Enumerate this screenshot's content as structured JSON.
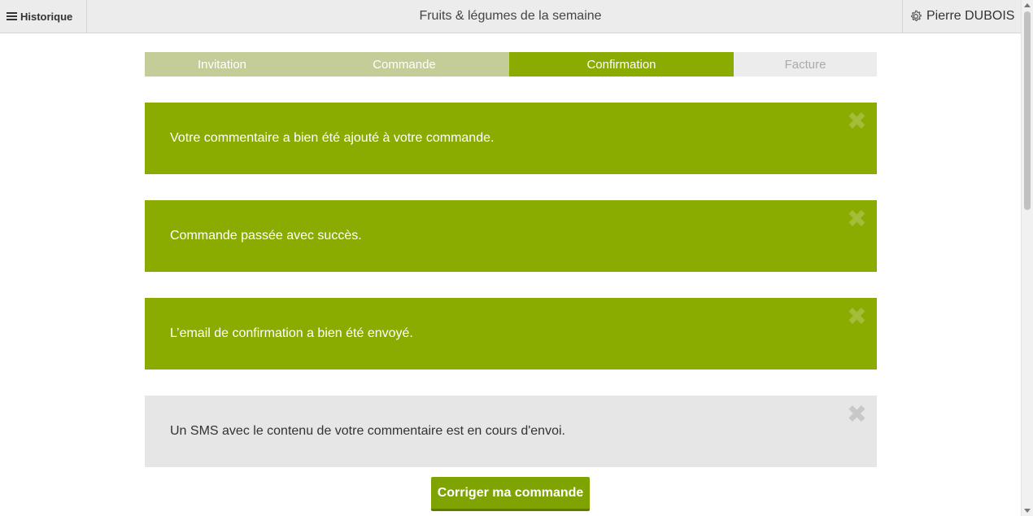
{
  "header": {
    "history_label": "Historique",
    "title": "Fruits & légumes de la semaine",
    "user_name": "Pierre DUBOIS"
  },
  "steps": [
    {
      "label": "Invitation",
      "state": "done"
    },
    {
      "label": "Commande",
      "state": "done"
    },
    {
      "label": "Confirmation",
      "state": "active"
    },
    {
      "label": "Facture",
      "state": "todo"
    }
  ],
  "alerts": [
    {
      "message": "Votre commentaire a bien été ajouté à votre commande.",
      "type": "success",
      "close": "✖"
    },
    {
      "message": "Commande passée avec succès.",
      "type": "success",
      "close": "✖"
    },
    {
      "message": "L’email de confirmation a bien été envoyé.",
      "type": "success",
      "close": "✖"
    },
    {
      "message": "Un SMS avec le contenu de votre commentaire est en cours d'envoi.",
      "type": "info",
      "close": "✖"
    }
  ],
  "actions": {
    "fix_order_label": "Corriger ma commande"
  },
  "colors": {
    "accent": "#8aab00",
    "step_done": "#c4cd97",
    "step_todo": "#ececec",
    "info_bg": "#e6e6e6"
  }
}
